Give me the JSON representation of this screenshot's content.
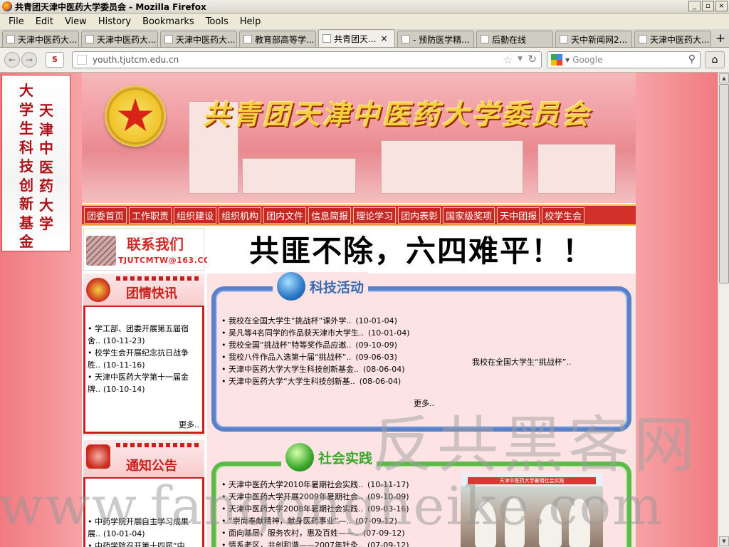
{
  "window": {
    "title": "共青团天津中医药大学委员会 - Mozilla Firefox",
    "controls": [
      "_",
      "▫",
      "×"
    ]
  },
  "menu": [
    "File",
    "Edit",
    "View",
    "History",
    "Bookmarks",
    "Tools",
    "Help"
  ],
  "tabs": [
    {
      "label": "天津中医药大..."
    },
    {
      "label": "天津中医药大..."
    },
    {
      "label": "天津中医药大..."
    },
    {
      "label": "教育部高等学..."
    },
    {
      "label": "共青团天...",
      "active": true
    },
    {
      "label": "- 预防医学精..."
    },
    {
      "label": "后勤在线"
    },
    {
      "label": "天中新闻网2..."
    },
    {
      "label": "天津中医药大..."
    }
  ],
  "new_tab": "+",
  "toolbar": {
    "url": "youth.tjutcm.edu.cn",
    "search_placeholder": "Google",
    "back": "←",
    "forward": "→",
    "ext": "S",
    "home": "⌂"
  },
  "float_ad": {
    "col1": [
      "大",
      "学",
      "生",
      "科",
      "技",
      "创",
      "新",
      "基",
      "金"
    ],
    "col2": [
      "天",
      "津",
      "中",
      "医",
      "药",
      "大",
      "学"
    ]
  },
  "banner": {
    "title": "共青团天津中医药大学委员会"
  },
  "nav": [
    "团委首页",
    "工作职责",
    "组织建设",
    "组织机构",
    "团内文件",
    "信息简报",
    "理论学习",
    "团内表彰",
    "国家级奖项",
    "天中团报",
    "校学生会"
  ],
  "contact": {
    "heading": "联系我们",
    "email": "TJUTCMTW@163.COM"
  },
  "tuanqing": {
    "title": "团情快讯",
    "items": [
      {
        "text": "• 学工部、团委开展第五届宿舍..",
        "date": "(10-11-23)"
      },
      {
        "text": "• 校学生会开展纪念抗日战争胜..",
        "date": "(10-11-16)"
      },
      {
        "text": "• 天津中医药大学第十一届金牌..",
        "date": "(10-10-14)"
      }
    ],
    "more": "更多.."
  },
  "notice": {
    "title": "通知公告",
    "items": [
      {
        "text": "• 中药学院开展自主学习成果展..",
        "date": "(10-01-04)"
      },
      {
        "text": "• 中药学院召开第十四届“中",
        "date": ""
      }
    ]
  },
  "slogan": "共匪不除，六四难平！！",
  "keji": {
    "title": "科技活动",
    "items": [
      {
        "text": "• 我校在全国大学生“挑战杯”课外学..",
        "date": "(10-01-04)"
      },
      {
        "text": "• 吴凡等4名同学的作品获天津市大学生..",
        "date": "(10-01-04)"
      },
      {
        "text": "• 我校全国“挑战杯”特等奖作品应邀..",
        "date": "(09-10-09)"
      },
      {
        "text": "• 我校八件作品入选第十届“挑战杯”..",
        "date": "(09-06-03)"
      },
      {
        "text": "• 天津中医药大学大学生科技创新基金..",
        "date": "(08-06-04)"
      },
      {
        "text": "• 天津中医药大学“大学生科技创新基..",
        "date": "(08-06-04)"
      }
    ],
    "featured": "我校在全国大学生“挑战杯”..",
    "more": "更多.."
  },
  "shehui": {
    "title": "社会实践",
    "items": [
      {
        "text": "• 天津中医药大学2010年暑期社会实践..",
        "date": "(10-11-17)"
      },
      {
        "text": "• 天津中医药大学开展2009年暑期社会..",
        "date": "(09-10-09)"
      },
      {
        "text": "• 天津中医药大学2008年暑期社会实践..",
        "date": "(09-03-16)"
      },
      {
        "text": "• “崇尚奉献精神，献身医药事业”—..",
        "date": "(07-09-12)"
      },
      {
        "text": "• 面向基层，服务农村，惠及百姓——..",
        "date": "(07-09-12)"
      },
      {
        "text": "• 情系老区，共创和谐——2007年针灸..",
        "date": "(07-09-12)"
      }
    ],
    "photo_banner": "天津中医药大学暑期社会实践"
  },
  "watermarks": [
    "反共黑客网",
    "www.fangongheike.com"
  ],
  "colors": {
    "page_bg": "#f6a5a8",
    "nav_red": "#d2302a",
    "blue_panel": "#5a80c8",
    "green_panel": "#5bbb46",
    "title_gold": "#f5d040"
  }
}
